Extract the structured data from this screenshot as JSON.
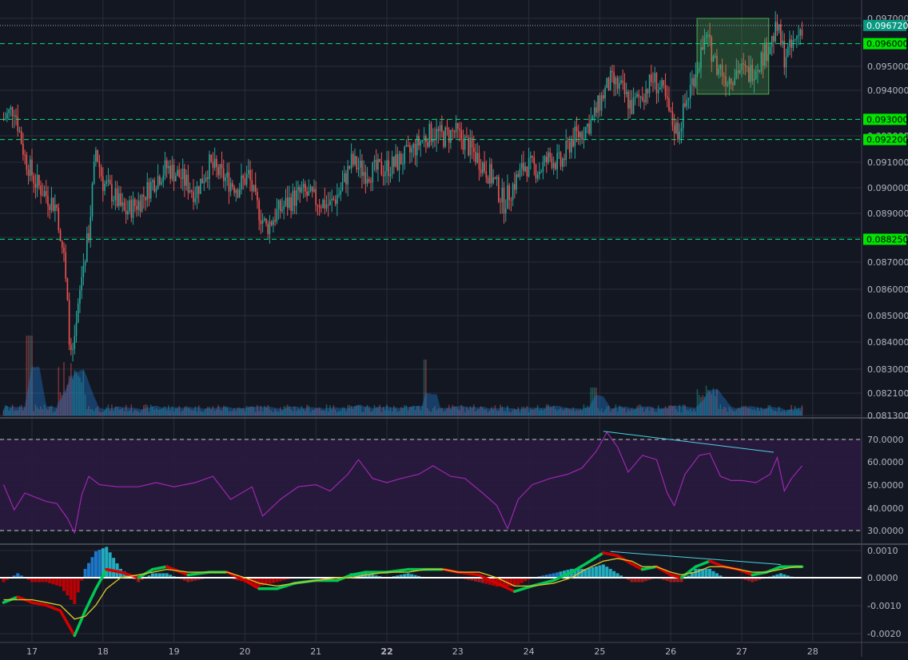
{
  "colors": {
    "background": "#131722",
    "grid": "#2a2e39",
    "candle_up": "#26a69a",
    "candle_down": "#ef5350",
    "level_line": "#00e676",
    "level_label_bg": "#00e600",
    "current_price_bg": "#089981",
    "box_fill": "#4caf50",
    "volume_ma": "#1e88e5",
    "rsi_line": "#9c27b0",
    "rsi_band": "#2a1a3e",
    "macd_line": "#00c853",
    "signal_line": "#d4c125",
    "divergence": "#4dd0e1",
    "axis_text": "#b2b5be"
  },
  "chart_data": [
    {
      "type": "candlestick",
      "name": "price",
      "x_ticks": [
        "17",
        "18",
        "19",
        "20",
        "21",
        "22",
        "23",
        "24",
        "25",
        "26",
        "27",
        "28"
      ],
      "x_tick_bold": "22",
      "y_ticks": [
        "0.097000",
        "0.095000",
        "0.094000",
        "0.092000",
        "0.091000",
        "0.090000",
        "0.089000",
        "0.088000",
        "0.087000",
        "0.086000",
        "0.085000",
        "0.084000",
        "0.083000",
        "0.082100",
        "0.081300"
      ],
      "ylim": [
        0.0813,
        0.0972
      ],
      "xlim": [
        16.6,
        28.3
      ],
      "current_price": "0.096720",
      "current_price_value": 0.09672,
      "levels": [
        {
          "label": "0.096000",
          "value": 0.096
        },
        {
          "label": "0.093000",
          "value": 0.093
        },
        {
          "label": "0.092200",
          "value": 0.0922
        },
        {
          "label": "0.088250",
          "value": 0.08825
        }
      ],
      "box": {
        "x": [
          26.37,
          27.38
        ],
        "y": [
          0.094,
          0.097
        ]
      },
      "close_path": [
        [
          16.6,
          0.093
        ],
        [
          16.75,
          0.0935
        ],
        [
          16.9,
          0.0915
        ],
        [
          17.05,
          0.0905
        ],
        [
          17.2,
          0.09
        ],
        [
          17.35,
          0.0895
        ],
        [
          17.45,
          0.0875
        ],
        [
          17.55,
          0.0835
        ],
        [
          17.6,
          0.084
        ],
        [
          17.7,
          0.0868
        ],
        [
          17.8,
          0.0885
        ],
        [
          17.9,
          0.0918
        ],
        [
          18.0,
          0.0905
        ],
        [
          18.15,
          0.09
        ],
        [
          18.3,
          0.0893
        ],
        [
          18.5,
          0.0897
        ],
        [
          18.7,
          0.0905
        ],
        [
          18.9,
          0.0911
        ],
        [
          19.1,
          0.0907
        ],
        [
          19.3,
          0.0901
        ],
        [
          19.5,
          0.0912
        ],
        [
          19.7,
          0.0907
        ],
        [
          19.9,
          0.0903
        ],
        [
          20.05,
          0.0908
        ],
        [
          20.15,
          0.0897
        ],
        [
          20.3,
          0.0887
        ],
        [
          20.45,
          0.0893
        ],
        [
          20.6,
          0.0897
        ],
        [
          20.8,
          0.0901
        ],
        [
          21.0,
          0.0898
        ],
        [
          21.2,
          0.0896
        ],
        [
          21.35,
          0.0902
        ],
        [
          21.5,
          0.0913
        ],
        [
          21.7,
          0.0909
        ],
        [
          21.9,
          0.091
        ],
        [
          22.1,
          0.0912
        ],
        [
          22.3,
          0.0916
        ],
        [
          22.5,
          0.0922
        ],
        [
          22.65,
          0.0925
        ],
        [
          22.8,
          0.0923
        ],
        [
          22.95,
          0.0925
        ],
        [
          23.1,
          0.0921
        ],
        [
          23.3,
          0.0914
        ],
        [
          23.5,
          0.0906
        ],
        [
          23.65,
          0.0897
        ],
        [
          23.8,
          0.0905
        ],
        [
          23.95,
          0.0912
        ],
        [
          24.15,
          0.091
        ],
        [
          24.3,
          0.0915
        ],
        [
          24.45,
          0.0912
        ],
        [
          24.6,
          0.0922
        ],
        [
          24.75,
          0.0925
        ],
        [
          24.9,
          0.093
        ],
        [
          25.05,
          0.094
        ],
        [
          25.15,
          0.0945
        ],
        [
          25.3,
          0.0942
        ],
        [
          25.45,
          0.0935
        ],
        [
          25.6,
          0.094
        ],
        [
          25.75,
          0.0946
        ],
        [
          25.9,
          0.094
        ],
        [
          26.0,
          0.093
        ],
        [
          26.1,
          0.0925
        ],
        [
          26.2,
          0.0935
        ],
        [
          26.35,
          0.095
        ],
        [
          26.5,
          0.0962
        ],
        [
          26.65,
          0.0952
        ],
        [
          26.8,
          0.0946
        ],
        [
          26.95,
          0.095
        ],
        [
          27.1,
          0.0948
        ],
        [
          27.25,
          0.0953
        ],
        [
          27.4,
          0.096
        ],
        [
          27.5,
          0.0966
        ],
        [
          27.6,
          0.0955
        ],
        [
          27.7,
          0.0958
        ],
        [
          27.85,
          0.0967
        ]
      ],
      "candle_step": 0.025
    },
    {
      "type": "line",
      "name": "rsi",
      "y_ticks": [
        "70.0000",
        "60.0000",
        "50.0000",
        "40.0000",
        "30.0000"
      ],
      "ylim": [
        24,
        82
      ],
      "band": [
        30,
        70
      ],
      "path": [
        [
          16.6,
          52
        ],
        [
          16.75,
          40
        ],
        [
          16.9,
          48
        ],
        [
          17.05,
          46
        ],
        [
          17.2,
          44
        ],
        [
          17.35,
          43
        ],
        [
          17.5,
          36
        ],
        [
          17.6,
          29
        ],
        [
          17.7,
          47
        ],
        [
          17.8,
          56
        ],
        [
          17.95,
          52
        ],
        [
          18.2,
          51
        ],
        [
          18.5,
          51
        ],
        [
          18.75,
          53
        ],
        [
          19.0,
          51
        ],
        [
          19.3,
          53
        ],
        [
          19.55,
          56
        ],
        [
          19.8,
          45
        ],
        [
          20.1,
          51
        ],
        [
          20.25,
          37
        ],
        [
          20.5,
          45
        ],
        [
          20.75,
          51
        ],
        [
          21.0,
          52
        ],
        [
          21.2,
          49
        ],
        [
          21.45,
          57
        ],
        [
          21.6,
          64
        ],
        [
          21.8,
          55
        ],
        [
          22.0,
          53
        ],
        [
          22.2,
          55
        ],
        [
          22.45,
          57
        ],
        [
          22.65,
          61
        ],
        [
          22.9,
          56
        ],
        [
          23.1,
          55
        ],
        [
          23.35,
          48
        ],
        [
          23.55,
          42
        ],
        [
          23.7,
          31
        ],
        [
          23.85,
          45
        ],
        [
          24.05,
          52
        ],
        [
          24.3,
          55
        ],
        [
          24.55,
          57
        ],
        [
          24.75,
          60
        ],
        [
          24.95,
          68
        ],
        [
          25.1,
          77
        ],
        [
          25.25,
          70
        ],
        [
          25.4,
          58
        ],
        [
          25.6,
          66
        ],
        [
          25.8,
          64
        ],
        [
          25.95,
          48
        ],
        [
          26.05,
          42
        ],
        [
          26.2,
          57
        ],
        [
          26.4,
          66
        ],
        [
          26.55,
          67
        ],
        [
          26.7,
          56
        ],
        [
          26.85,
          54
        ],
        [
          27.0,
          54
        ],
        [
          27.2,
          53
        ],
        [
          27.4,
          57
        ],
        [
          27.5,
          65
        ],
        [
          27.6,
          49
        ],
        [
          27.7,
          55
        ],
        [
          27.85,
          61
        ]
      ],
      "divergence": [
        [
          25.05,
          77.5
        ],
        [
          27.45,
          67.5
        ]
      ]
    },
    {
      "type": "macd",
      "name": "macd",
      "y_ticks": [
        "0.0010",
        "0.0000",
        "-0.0010",
        "-0.0020"
      ],
      "ylim": [
        -0.00225,
        0.00105
      ],
      "macd": [
        [
          16.6,
          -0.0009
        ],
        [
          16.8,
          -0.0007
        ],
        [
          17.0,
          -0.0009
        ],
        [
          17.2,
          -0.001
        ],
        [
          17.4,
          -0.0012
        ],
        [
          17.6,
          -0.0021
        ],
        [
          17.75,
          -0.0012
        ],
        [
          17.9,
          -0.0004
        ],
        [
          18.05,
          0.0003
        ],
        [
          18.25,
          0.0002
        ],
        [
          18.5,
          0.0
        ],
        [
          18.7,
          0.0003
        ],
        [
          18.9,
          0.0004
        ],
        [
          19.2,
          0.0001
        ],
        [
          19.5,
          0.0002
        ],
        [
          19.75,
          0.0002
        ],
        [
          20.0,
          -0.0001
        ],
        [
          20.2,
          -0.0004
        ],
        [
          20.45,
          -0.0004
        ],
        [
          20.7,
          -0.0002
        ],
        [
          21.0,
          -0.0001
        ],
        [
          21.3,
          -0.0001
        ],
        [
          21.5,
          0.0001
        ],
        [
          21.7,
          0.0002
        ],
        [
          22.0,
          0.0002
        ],
        [
          22.3,
          0.0003
        ],
        [
          22.55,
          0.0003
        ],
        [
          22.8,
          0.0003
        ],
        [
          23.0,
          0.0002
        ],
        [
          23.3,
          0.0001
        ],
        [
          23.55,
          -0.0002
        ],
        [
          23.8,
          -0.0005
        ],
        [
          24.05,
          -0.0003
        ],
        [
          24.35,
          -0.0001
        ],
        [
          24.6,
          0.0002
        ],
        [
          24.8,
          0.0005
        ],
        [
          25.05,
          0.0009
        ],
        [
          25.25,
          0.0008
        ],
        [
          25.45,
          0.0005
        ],
        [
          25.6,
          0.0003
        ],
        [
          25.8,
          0.0004
        ],
        [
          26.0,
          0.0001
        ],
        [
          26.15,
          0.0
        ],
        [
          26.35,
          0.0004
        ],
        [
          26.55,
          0.0006
        ],
        [
          26.75,
          0.0004
        ],
        [
          26.95,
          0.0003
        ],
        [
          27.15,
          0.0001
        ],
        [
          27.35,
          0.0002
        ],
        [
          27.55,
          0.0004
        ],
        [
          27.75,
          0.0004
        ],
        [
          27.85,
          0.0004
        ]
      ],
      "signal": [
        [
          16.6,
          -0.0008
        ],
        [
          16.8,
          -0.0008
        ],
        [
          17.0,
          -0.0008
        ],
        [
          17.2,
          -0.0009
        ],
        [
          17.4,
          -0.001
        ],
        [
          17.6,
          -0.0015
        ],
        [
          17.75,
          -0.0014
        ],
        [
          17.9,
          -0.001
        ],
        [
          18.05,
          -0.0004
        ],
        [
          18.25,
          0.0
        ],
        [
          18.5,
          0.0001
        ],
        [
          18.7,
          0.0002
        ],
        [
          18.9,
          0.0003
        ],
        [
          19.2,
          0.0002
        ],
        [
          19.5,
          0.0002
        ],
        [
          19.75,
          0.0002
        ],
        [
          20.0,
          0.0
        ],
        [
          20.2,
          -0.0002
        ],
        [
          20.45,
          -0.0003
        ],
        [
          20.7,
          -0.0002
        ],
        [
          21.0,
          -0.0001
        ],
        [
          21.3,
          0.0
        ],
        [
          21.5,
          0.0
        ],
        [
          21.7,
          0.0001
        ],
        [
          22.0,
          0.0002
        ],
        [
          22.3,
          0.0002
        ],
        [
          22.55,
          0.0003
        ],
        [
          22.8,
          0.0003
        ],
        [
          23.0,
          0.0002
        ],
        [
          23.3,
          0.0002
        ],
        [
          23.55,
          0.0
        ],
        [
          23.8,
          -0.0003
        ],
        [
          24.05,
          -0.0003
        ],
        [
          24.35,
          -0.0002
        ],
        [
          24.6,
          0.0
        ],
        [
          24.8,
          0.0003
        ],
        [
          25.05,
          0.0006
        ],
        [
          25.25,
          0.0007
        ],
        [
          25.45,
          0.0006
        ],
        [
          25.6,
          0.0004
        ],
        [
          25.8,
          0.0004
        ],
        [
          26.0,
          0.0002
        ],
        [
          26.15,
          0.0001
        ],
        [
          26.35,
          0.0002
        ],
        [
          26.55,
          0.0004
        ],
        [
          26.75,
          0.0004
        ],
        [
          26.95,
          0.0003
        ],
        [
          27.15,
          0.0002
        ],
        [
          27.35,
          0.0002
        ],
        [
          27.55,
          0.0003
        ],
        [
          27.75,
          0.0004
        ],
        [
          27.85,
          0.0004
        ]
      ],
      "divergence": [
        [
          25.15,
          0.00095
        ],
        [
          27.55,
          0.00048
        ]
      ]
    }
  ]
}
